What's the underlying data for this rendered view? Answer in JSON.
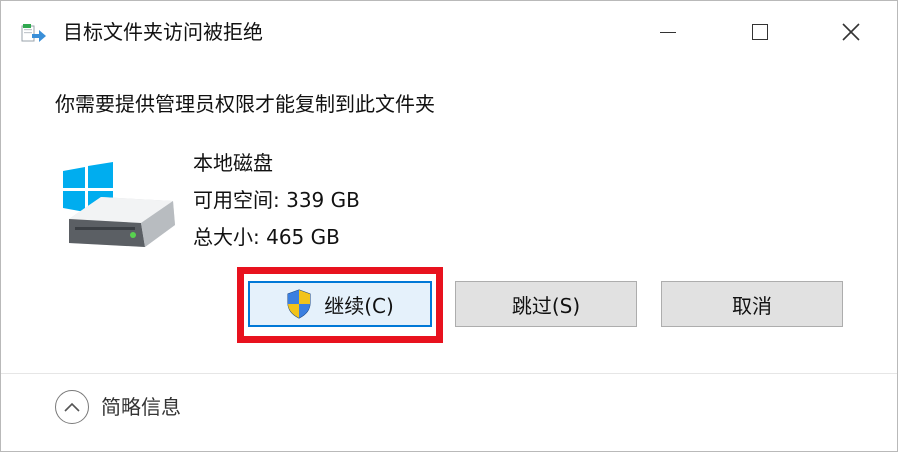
{
  "window": {
    "title": "目标文件夹访问被拒绝",
    "minimize_icon": "minimize-icon",
    "maximize_icon": "maximize-icon",
    "close_icon": "close-icon"
  },
  "message": "你需要提供管理员权限才能复制到此文件夹",
  "drive": {
    "icon": "drive-icon",
    "name": "本地磁盘",
    "free_space": "可用空间: 339 GB",
    "total_size": "总大小: 465 GB"
  },
  "buttons": {
    "continue_label": "继续(C)",
    "continue_icon": "uac-shield-icon",
    "skip_label": "跳过(S)",
    "cancel_label": "取消"
  },
  "footer": {
    "details_label": "简略信息",
    "details_icon": "chevron-up-icon"
  },
  "colors": {
    "highlight_border": "#e8121e",
    "default_button_border": "#0078d7",
    "windows_logo_blue": "#00adef"
  }
}
